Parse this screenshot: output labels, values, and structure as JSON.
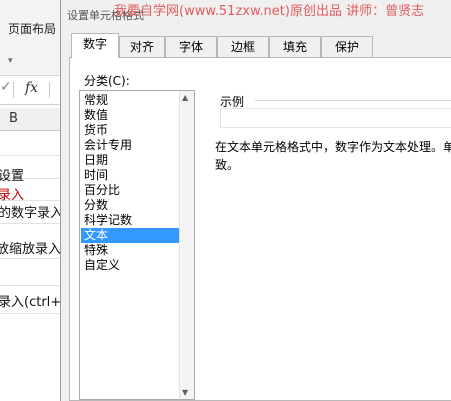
{
  "background": {
    "ribbon_tab": "页面布局",
    "fx_check": "✓",
    "fx_label": "fx",
    "column_letter": "B",
    "cells": [
      "设置",
      "录入",
      "的数字录入",
      "放缩放录入",
      "录入(ctrl+D"
    ]
  },
  "dialog": {
    "title": "设置单元格格式",
    "watermark": "我要自学网(www.51zxw.net)原创出品   讲师：曾贤志",
    "tabs": [
      "数字",
      "对齐",
      "字体",
      "边框",
      "填充",
      "保护"
    ],
    "active_tab": "数字",
    "category_label": "分类(C):",
    "categories": [
      "常规",
      "数值",
      "货币",
      "会计专用",
      "日期",
      "时间",
      "百分比",
      "分数",
      "科学记数",
      "文本",
      "特殊",
      "自定义"
    ],
    "selected_category": "文本",
    "sample_label": "示例",
    "description_line1": "在文本单元格格式中，数字作为文本处理。单元",
    "description_line2": "致。"
  },
  "colors": {
    "selection": "#3399ff",
    "watermark": "#e05050",
    "red_text": "#c00000"
  }
}
